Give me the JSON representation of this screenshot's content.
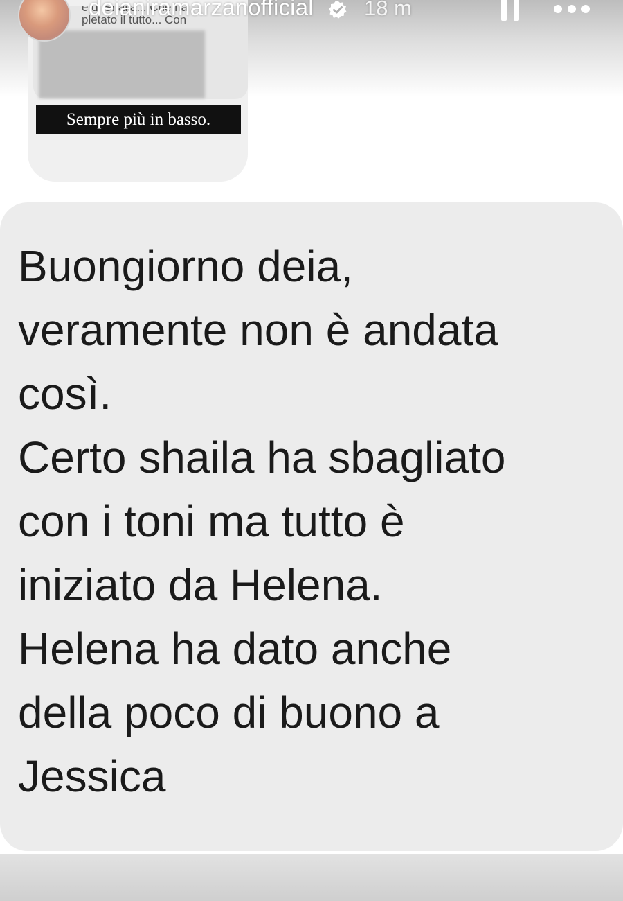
{
  "header": {
    "username": "deianiramarzanofficial",
    "time": "18 m",
    "verified_icon": "verified-badge-icon",
    "pause_icon": "pause-icon",
    "more_icon": "more-options-icon"
  },
  "quoted_story": {
    "text": "e di Shaila... Che ha\npletato il tutto... Con",
    "caption": "Sempre più in basso."
  },
  "message": {
    "text": "Buongiorno deia,\nveramente non è andata\ncosì.\nCerto shaila ha sbagliato\ncon i toni ma tutto è\niniziato da Helena.\nHelena ha dato anche\ndella poco di buono a\nJessica"
  },
  "colors": {
    "message_bg": "#ececec",
    "text": "#1a1a1a",
    "caption_bg": "#111111"
  }
}
